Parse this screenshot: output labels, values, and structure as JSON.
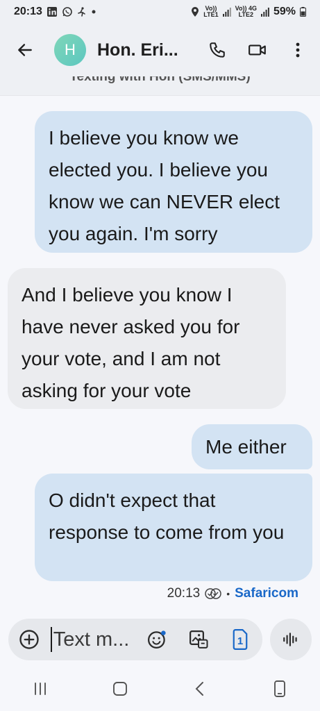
{
  "status_bar": {
    "time": "20:13",
    "net1_top": "Vo))",
    "net1_bottom": "LTE1",
    "net2_top": "Vo)) 4G",
    "net2_bottom": "LTE2",
    "battery": "59%"
  },
  "header": {
    "avatar_letter": "H",
    "contact_name": "Hon. Eri...",
    "subtitle": "Texting with Hon (SMS/MMS)"
  },
  "messages": [
    {
      "direction": "outgoing",
      "text": "I believe you know we elected you. I believe you know we can NEVER elect you again. I'm sorry"
    },
    {
      "direction": "incoming",
      "text": "And I believe you know I have never asked you for your vote, and I am not asking for your vote"
    },
    {
      "direction": "outgoing",
      "text": "Me either"
    },
    {
      "direction": "outgoing",
      "text": "O didn't expect that response to come from you"
    }
  ],
  "message_meta": {
    "time": "20:13",
    "separator": "•",
    "carrier": "Safaricom"
  },
  "compose": {
    "placeholder": "Text m...",
    "sim_number": "1"
  },
  "colors": {
    "outgoing_bubble": "#d3e3f3",
    "incoming_bubble": "#ebecef",
    "carrier": "#1a68c8"
  }
}
